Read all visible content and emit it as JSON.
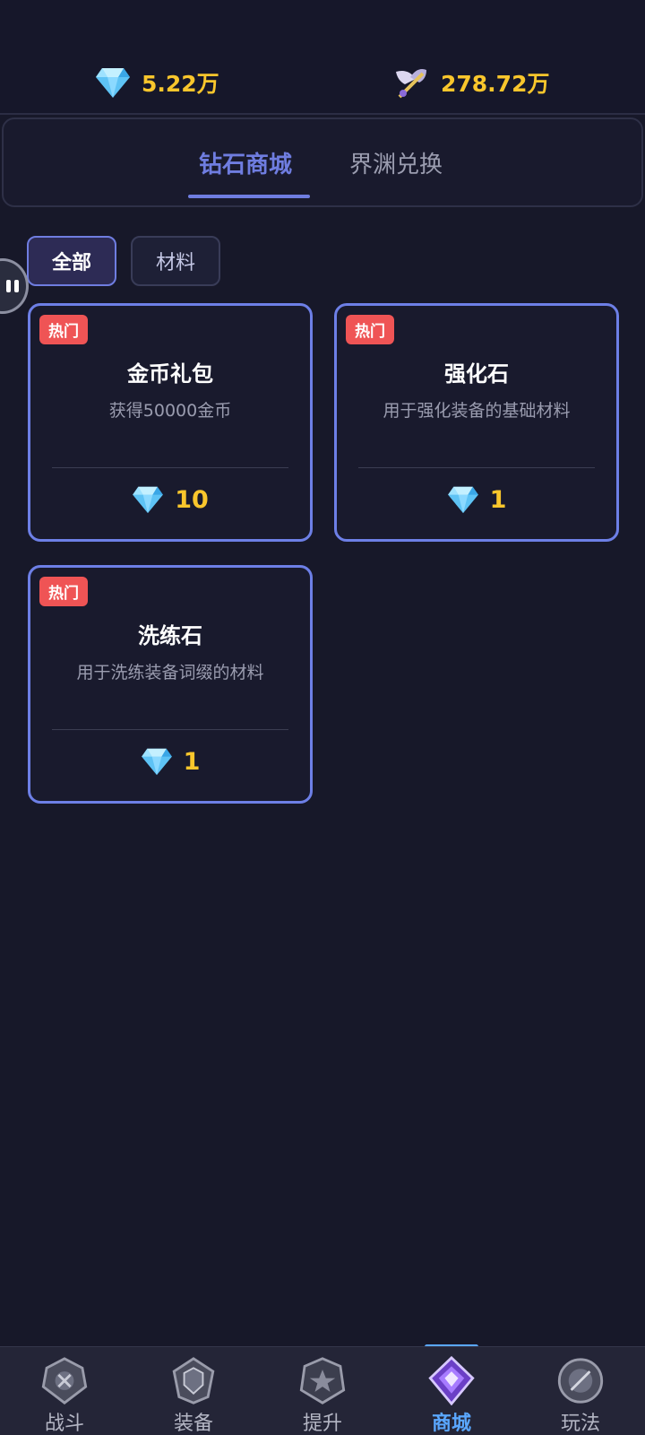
{
  "currency": {
    "diamond": {
      "icon": "diamond-icon",
      "value": "5.22万"
    },
    "wing": {
      "icon": "winged-sword-icon",
      "value": "278.72万"
    }
  },
  "tabs": [
    {
      "label": "钻石商城",
      "active": true
    },
    {
      "label": "界渊兑换",
      "active": false
    }
  ],
  "filters": [
    {
      "label": "全部",
      "active": true
    },
    {
      "label": "材料",
      "active": false
    }
  ],
  "products": [
    {
      "badge": "热门",
      "title": "金币礼包",
      "description": "获得50000金币",
      "price": "10",
      "price_icon": "diamond-icon"
    },
    {
      "badge": "热门",
      "title": "强化石",
      "description": "用于强化装备的基础材料",
      "price": "1",
      "price_icon": "diamond-icon"
    },
    {
      "badge": "热门",
      "title": "洗练石",
      "description": "用于洗练装备词缀的材料",
      "price": "1",
      "price_icon": "diamond-icon"
    }
  ],
  "nav": [
    {
      "label": "战斗",
      "icon": "battle-emblem-icon",
      "active": false
    },
    {
      "label": "装备",
      "icon": "equipment-emblem-icon",
      "active": false
    },
    {
      "label": "提升",
      "icon": "upgrade-emblem-icon",
      "active": false
    },
    {
      "label": "商城",
      "icon": "shop-emblem-icon",
      "active": true
    },
    {
      "label": "玩法",
      "icon": "gameplay-orb-icon",
      "active": false
    }
  ],
  "colors": {
    "background": "#171829",
    "accent": "#6f7de0",
    "gold": "#f9c62c",
    "hot_badge": "#ef5455",
    "nav_active": "#5aa7ff"
  }
}
